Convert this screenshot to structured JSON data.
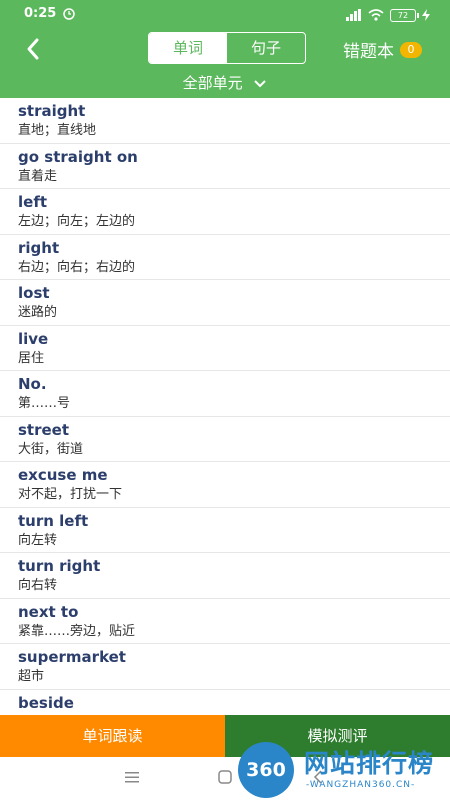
{
  "status": {
    "time": "0:25",
    "battery": "72"
  },
  "header": {
    "tabs": [
      {
        "label": "单词",
        "active": true
      },
      {
        "label": "句子",
        "active": false
      }
    ],
    "wrong_book": {
      "label": "错题本",
      "count": "0"
    },
    "unit_selector": "全部单元"
  },
  "words": [
    {
      "en": "straight",
      "zh": "直地；直线地"
    },
    {
      "en": "go straight on",
      "zh": "直着走"
    },
    {
      "en": "left",
      "zh": "左边；向左；左边的"
    },
    {
      "en": "right",
      "zh": "右边；向右；右边的"
    },
    {
      "en": "lost",
      "zh": "迷路的"
    },
    {
      "en": "live",
      "zh": "居住"
    },
    {
      "en": "No.",
      "zh": "第……号"
    },
    {
      "en": "street",
      "zh": "大街，街道"
    },
    {
      "en": "excuse me",
      "zh": "对不起，打扰一下"
    },
    {
      "en": "turn left",
      "zh": "向左转"
    },
    {
      "en": "turn right",
      "zh": "向右转"
    },
    {
      "en": "next to",
      "zh": "紧靠……旁边，贴近"
    },
    {
      "en": "supermarket",
      "zh": "超市"
    },
    {
      "en": "beside",
      "zh": ""
    }
  ],
  "bottom": {
    "follow_read": "单词跟读",
    "mock_test": "模拟测评"
  },
  "watermark": {
    "logo": "360",
    "title": "网站排行榜",
    "subtitle": "-WANGZHAN360.CN-"
  },
  "colors": {
    "primary": "#5cb85c",
    "orange": "#ff8a00",
    "dark_green": "#2e7d2e",
    "badge": "#f2b600",
    "word_text": "#2c3e6b"
  }
}
